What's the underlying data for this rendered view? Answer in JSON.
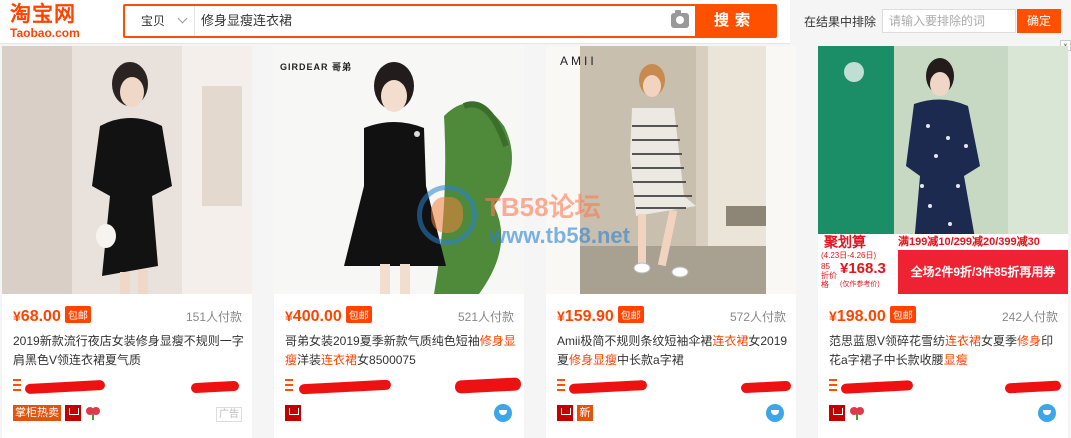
{
  "header": {
    "logo_cn": "淘宝网",
    "logo_en": "Taobao.com",
    "scope": "宝贝",
    "query": "修身显瘦连衣裙",
    "search_label": "搜索",
    "exclude_label": "在结果中排除",
    "exclude_placeholder": "请输入要排除的词",
    "exclude_btn": "确定"
  },
  "watermark": {
    "line1": "TB58论坛",
    "line2": "www.tb58.net"
  },
  "products": [
    {
      "yen": "¥",
      "price": "68.00",
      "free_ship": "包邮",
      "sold": "151人付款",
      "title": "2019新款流行夜店女装修身显瘦不规则一字肩黑色V领连衣裙夏气质",
      "badge_hot": "掌柜热卖",
      "ad": "广告"
    },
    {
      "yen": "¥",
      "price": "400.00",
      "free_ship": "包邮",
      "sold": "521人付款",
      "title_a": "哥弟女装2019夏季新款气质纯色短袖",
      "title_hl1": "修身显瘦",
      "title_b": "洋装",
      "title_hl2": "连衣裙",
      "title_c": "女8500075",
      "brand_logo": "GIRDEAR 哥弟"
    },
    {
      "yen": "¥",
      "price": "159.90",
      "free_ship": "包邮",
      "sold": "572人付款",
      "title_a": "Amii极简不规则条纹短袖伞裙",
      "title_hl1": "连衣裙",
      "title_b": "女2019夏",
      "title_hl2": "修身显瘦",
      "title_c": "中长款a字裙",
      "brand_logo": "AMII",
      "badge_new": "新"
    },
    {
      "yen": "¥",
      "price": "198.00",
      "free_ship": "包邮",
      "sold": "242人付款",
      "title_a": "范思蓝恩V领碎花雪纺",
      "title_hl1": "连衣裙",
      "title_b": "女夏季",
      "title_hl2": "修身",
      "title_c": "印花a字裙子中长款收腰",
      "title_hl3": "显瘦",
      "promo_tag": "聚划算",
      "promo_date": "(4.23日-4.26日)",
      "promo_discount": "满199减10/299减20/399减30",
      "promo_price_label": "85折价格",
      "promo_price": "¥168.3",
      "promo_note": "(仅作参考价)",
      "promo_banner": "全场2件9折/3件85折再用券"
    }
  ],
  "colors": {
    "accent": "#ff4400",
    "brand": "#ff5000"
  }
}
